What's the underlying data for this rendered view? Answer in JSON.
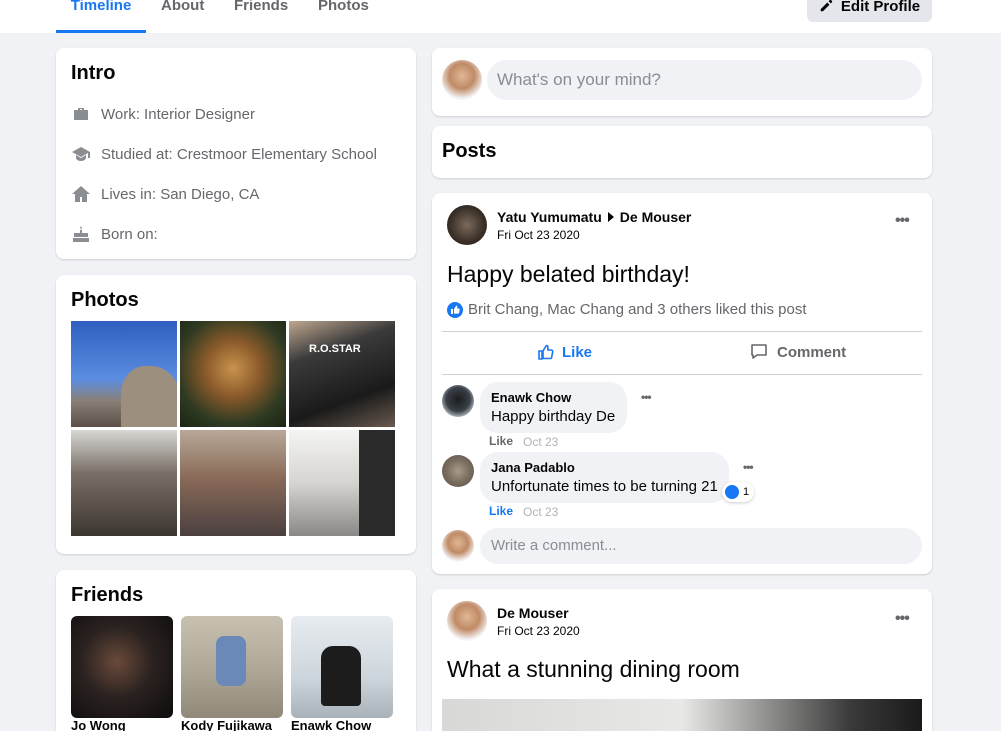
{
  "nav": {
    "tabs": [
      "Timeline",
      "About",
      "Friends",
      "Photos"
    ],
    "edit_profile": "Edit Profile"
  },
  "intro": {
    "title": "Intro",
    "work": "Work: Interior Designer",
    "studied": "Studied at: Crestmoor Elementary School",
    "lives": "Lives in: San Diego, CA",
    "born": "Born on:"
  },
  "photos": {
    "title": "Photos"
  },
  "friends": {
    "title": "Friends",
    "list": [
      "Jo Wong",
      "Kody Fujikawa",
      "Enawk Chow"
    ]
  },
  "composer": {
    "placeholder": "What's on your mind?"
  },
  "posts_header": "Posts",
  "post1": {
    "author": "Yatu Yumumatu",
    "target": "De Mouser",
    "date": "Fri Oct 23 2020",
    "text": "Happy belated birthday!",
    "likes_summary": "Brit Chang, Mac Chang and 3 others liked this post",
    "like_label": "Like",
    "comment_label": "Comment",
    "comments": [
      {
        "author": "Enawk Chow",
        "text": "Happy birthday De",
        "like": "Like",
        "date": "Oct 23"
      },
      {
        "author": "Jana Padablo",
        "text": "Unfortunate times to be turning 21",
        "like": "Like",
        "date": "Oct 23",
        "reactions": "1"
      }
    ],
    "comment_placeholder": "Write a comment..."
  },
  "post2": {
    "author": "De Mouser",
    "date": "Fri Oct 23 2020",
    "text": "What a stunning dining room"
  },
  "colors": {
    "accent": "#1877f2",
    "background": "#f0f2f5",
    "muted": "#65676b"
  }
}
